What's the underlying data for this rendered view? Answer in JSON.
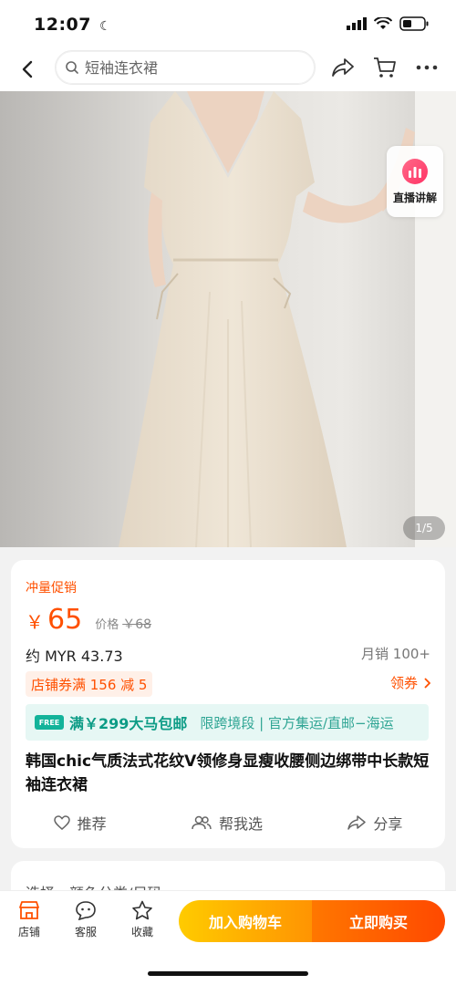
{
  "status": {
    "time": "12:07"
  },
  "search": {
    "placeholder": "短袖连衣裙"
  },
  "hero": {
    "page_indicator": "1/5",
    "live_label": "直播讲解"
  },
  "product": {
    "promo_tag": "冲量促销",
    "currency_symbol": "￥",
    "price": "65",
    "original_label": "价格",
    "original_price": "￥68",
    "converted_price": "约 MYR 43.73",
    "monthly_sales": "月销 100+",
    "coupon": "店铺券满 156 减 5",
    "claim_label": "领券",
    "shipping_badge": "FREE",
    "shipping_main": "满￥299大马包邮",
    "shipping_sub": "限跨境段 | 官方集运/直邮−海运",
    "title": "韩国chic气质法式花纹V领修身显瘦收腰侧边绑带中长款短袖连衣裙",
    "actions": {
      "recommend": "推荐",
      "help_choose": "帮我选",
      "share": "分享"
    }
  },
  "next_section": {
    "peek_text": "选择　颜色分类/尺码"
  },
  "bottom_bar": {
    "store": "店铺",
    "service": "客服",
    "favorite": "收藏",
    "add_cart": "加入购物车",
    "buy_now": "立即购买"
  }
}
